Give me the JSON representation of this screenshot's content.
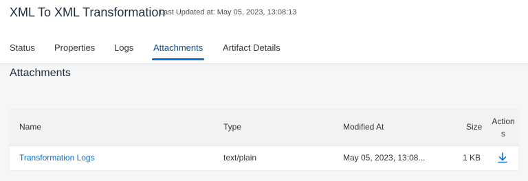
{
  "header": {
    "title": "XML To XML Transformation",
    "last_updated": "Last Updated at: May 05, 2023, 13:08:13"
  },
  "tabs": [
    {
      "label": "Status",
      "active": false
    },
    {
      "label": "Properties",
      "active": false
    },
    {
      "label": "Logs",
      "active": false
    },
    {
      "label": "Attachments",
      "active": true
    },
    {
      "label": "Artifact Details",
      "active": false
    }
  ],
  "section": {
    "title": "Attachments"
  },
  "table": {
    "columns": {
      "name": "Name",
      "type": "Type",
      "modified": "Modified At",
      "size": "Size",
      "actions": "Actions"
    },
    "rows": [
      {
        "name": "Transformation Logs",
        "type": "text/plain",
        "modified": "May 05, 2023, 13:08...",
        "size": "1 KB",
        "action_icon": "download-icon"
      }
    ]
  },
  "colors": {
    "accent": "#0a6ed1",
    "active_tab_text": "#0a4e8d",
    "background": "#f5f6f7"
  }
}
